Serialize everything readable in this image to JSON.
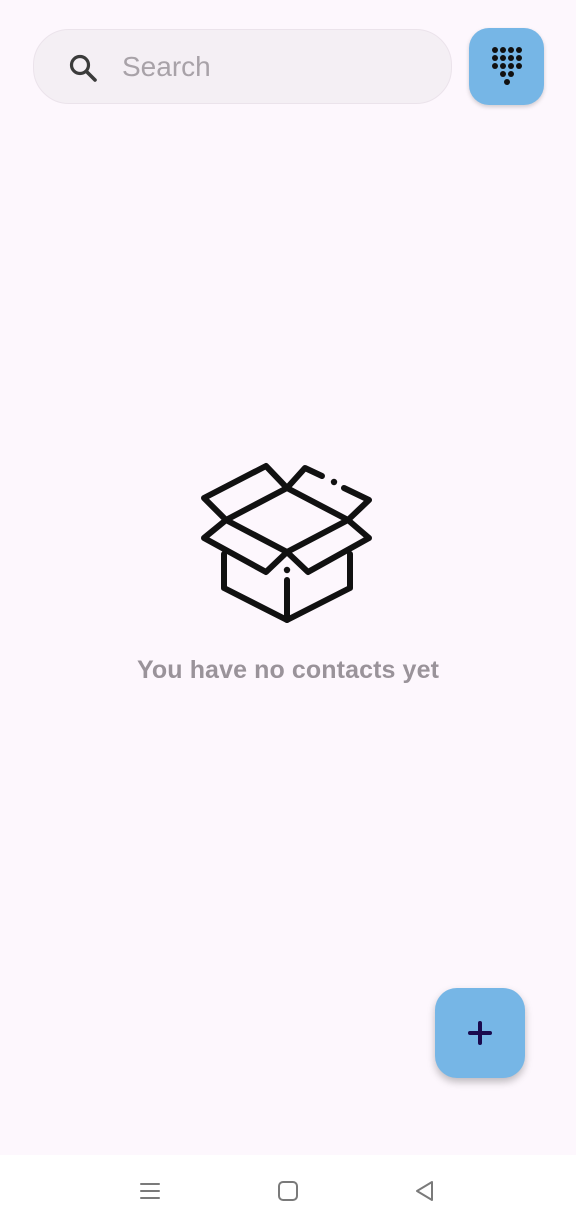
{
  "search": {
    "placeholder": "Search",
    "value": ""
  },
  "dialpad_button": {
    "icon": "dialpad-icon",
    "background": "#76b6e6"
  },
  "empty_state": {
    "icon": "open-box-icon",
    "message": "You have no contacts yet"
  },
  "fab": {
    "icon": "plus-icon",
    "background": "#76b6e6",
    "icon_color": "#1a0a4e"
  },
  "system_nav": {
    "items": [
      {
        "icon": "recents-icon"
      },
      {
        "icon": "home-icon"
      },
      {
        "icon": "back-icon"
      }
    ]
  },
  "theme": {
    "background": "#fdf7fd",
    "search_background": "#f4eff4",
    "muted_text": "#9a939a"
  }
}
